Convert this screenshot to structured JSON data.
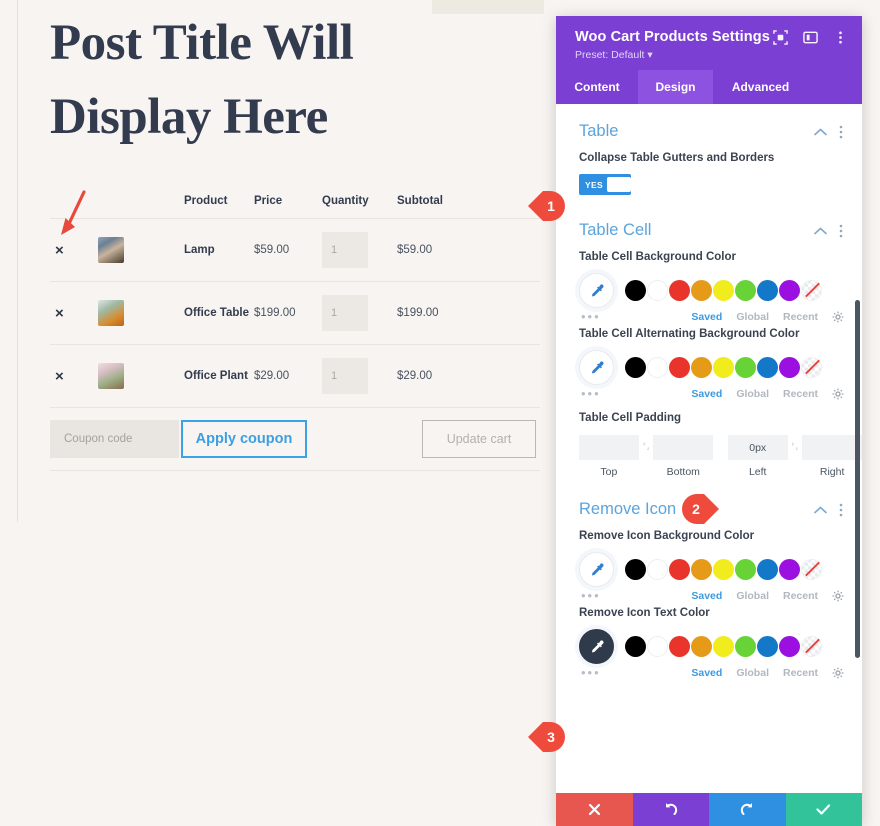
{
  "canvas": {
    "post_title": "Post Title Will Display Here",
    "table": {
      "headers": [
        "",
        "",
        "Product",
        "Price",
        "Quantity",
        "Subtotal"
      ],
      "rows": [
        {
          "remove": "×",
          "product": "Lamp",
          "price": "$59.00",
          "quantity": "1",
          "subtotal": "$59.00"
        },
        {
          "remove": "×",
          "product": "Office Table",
          "price": "$199.00",
          "quantity": "1",
          "subtotal": "$199.00"
        },
        {
          "remove": "×",
          "product": "Office Plant",
          "price": "$29.00",
          "quantity": "1",
          "subtotal": "$29.00"
        }
      ],
      "coupon_placeholder": "Coupon code",
      "apply_coupon_label": "Apply coupon",
      "update_cart_label": "Update cart"
    }
  },
  "panel": {
    "title": "Woo Cart Products Settings",
    "preset": "Preset: Default ▾",
    "tabs": [
      {
        "label": "Content",
        "active": false
      },
      {
        "label": "Design",
        "active": true
      },
      {
        "label": "Advanced",
        "active": false
      }
    ],
    "sections": [
      {
        "title": "Table",
        "fields": [
          {
            "label": "Collapse Table Gutters and Borders",
            "type": "toggle",
            "value": "YES"
          }
        ]
      },
      {
        "title": "Table Cell",
        "fields": [
          {
            "label": "Table Cell Background Color",
            "type": "color"
          },
          {
            "label": "Table Cell Alternating Background Color",
            "type": "color"
          },
          {
            "label": "Table Cell Padding",
            "type": "padding"
          }
        ]
      },
      {
        "title": "Remove Icon",
        "fields": [
          {
            "label": "Remove Icon Background Color",
            "type": "color"
          },
          {
            "label": "Remove Icon Text Color",
            "type": "color",
            "selected": true
          }
        ]
      }
    ],
    "color_meta": {
      "saved": "Saved",
      "global": "Global",
      "recent": "Recent"
    },
    "swatches": [
      "#000000",
      "#ffffff",
      "#e8342a",
      "#e59a18",
      "#f0ec1e",
      "#67d337",
      "#1478c8",
      "#9b0fe0",
      "transparent"
    ],
    "padding": {
      "top": {
        "value": "",
        "caption": "Top"
      },
      "bottom": {
        "value": "",
        "caption": "Bottom"
      },
      "left": {
        "value": "0px",
        "caption": "Left"
      },
      "right": {
        "value": "",
        "caption": "Right"
      },
      "link_glyph": "⸢⸥"
    },
    "footer_buttons": [
      {
        "name": "cancel",
        "glyph": "✕",
        "color": "#e8574f"
      },
      {
        "name": "undo",
        "glyph": "↺",
        "color": "#7b3fd4"
      },
      {
        "name": "redo",
        "glyph": "↻",
        "color": "#2f8fe0"
      },
      {
        "name": "save",
        "glyph": "✓",
        "color": "#32c39a"
      }
    ]
  },
  "annotations": {
    "badges": [
      {
        "number": "1"
      },
      {
        "number": "2"
      },
      {
        "number": "3"
      }
    ],
    "arrow_color": "#e8493c"
  }
}
